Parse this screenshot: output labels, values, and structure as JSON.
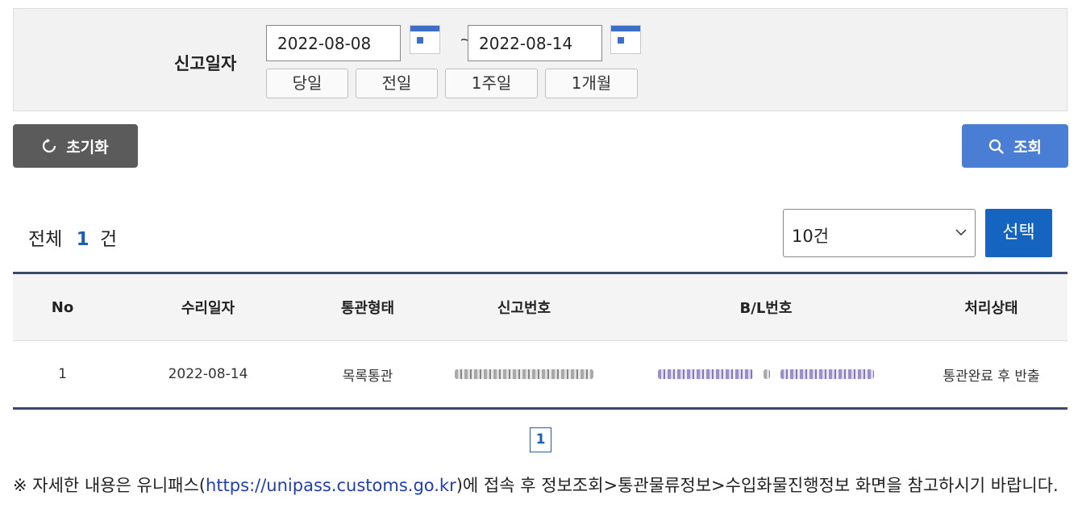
{
  "search": {
    "label": "신고일자",
    "date_from": "2022-08-08",
    "date_to": "2022-08-14",
    "tilde": "~",
    "period_buttons": [
      "당일",
      "전일",
      "1주일",
      "1개월"
    ]
  },
  "actions": {
    "reset_label": "초기화",
    "query_label": "조회"
  },
  "summary": {
    "prefix": "전체",
    "count": "1",
    "suffix": "건"
  },
  "page_size": {
    "selected": "10건",
    "select_button": "선택"
  },
  "table": {
    "headers": [
      "No",
      "수리일자",
      "통관형태",
      "신고번호",
      "B/L번호",
      "처리상태"
    ],
    "rows": [
      {
        "no": "1",
        "date": "2022-08-14",
        "type": "목록통관",
        "status": "통관완료 후 반출"
      }
    ]
  },
  "pagination": {
    "current": "1"
  },
  "notice": {
    "before": "※ 자세한 내용은 유니패스(",
    "link": "https://unipass.customs.go.kr",
    "after": ")에 접속 후 정보조회>통관물류정보>수입화물진행정보 화면을 참고하시기 바랍니다."
  },
  "colors": {
    "primary_blue": "#1565c0",
    "query_button": "#4a7dd4",
    "reset_button": "#5b5b5b",
    "table_border": "#3b4a6b"
  },
  "icons": {
    "calendar": "calendar-icon",
    "reset": "refresh-icon",
    "query": "search-icon",
    "dropdown": "chevron-down-icon"
  }
}
